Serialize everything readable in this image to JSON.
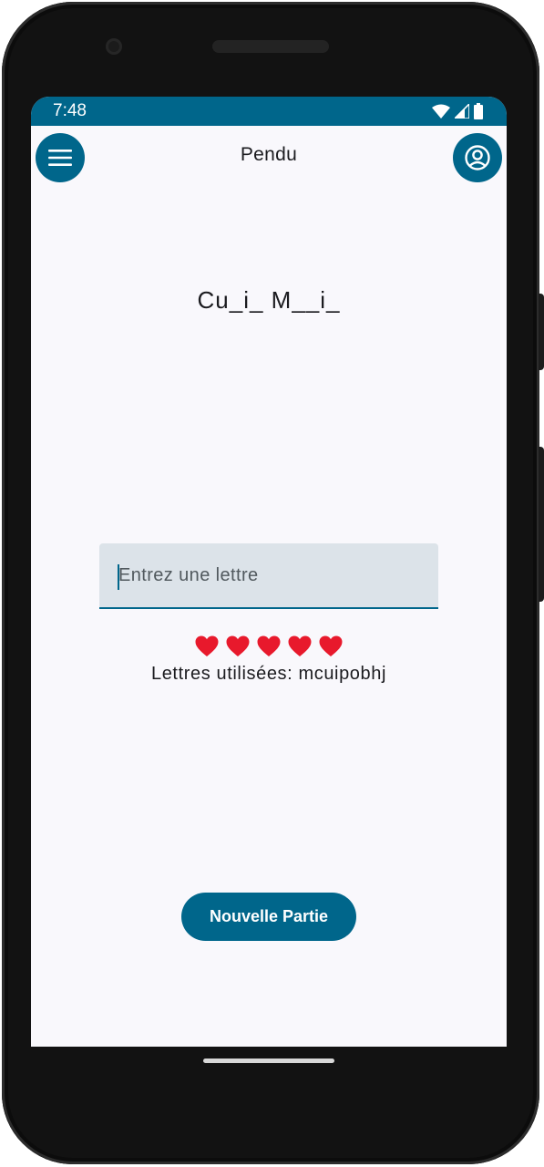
{
  "status_bar": {
    "time": "7:48",
    "icons": [
      "wifi-icon",
      "signal-icon",
      "battery-icon"
    ]
  },
  "app_bar": {
    "title": "Pendu",
    "menu_icon": "hamburger-menu-icon",
    "account_icon": "account-circle-icon"
  },
  "game": {
    "masked_word": "Cu_i_ M__i_",
    "letter_input": {
      "value": "",
      "placeholder": "Entrez une lettre"
    },
    "lives_remaining": 5,
    "lives_icon": "heart-icon",
    "used_letters": "Lettres utilisées: mcuipobhj"
  },
  "actions": {
    "new_game_label": "Nouvelle Partie"
  },
  "colors": {
    "primary": "#00668b",
    "background": "#f9f8fc",
    "field_background": "#dce3e9",
    "heart": "#e8192c",
    "text": "#1b1b1f"
  }
}
